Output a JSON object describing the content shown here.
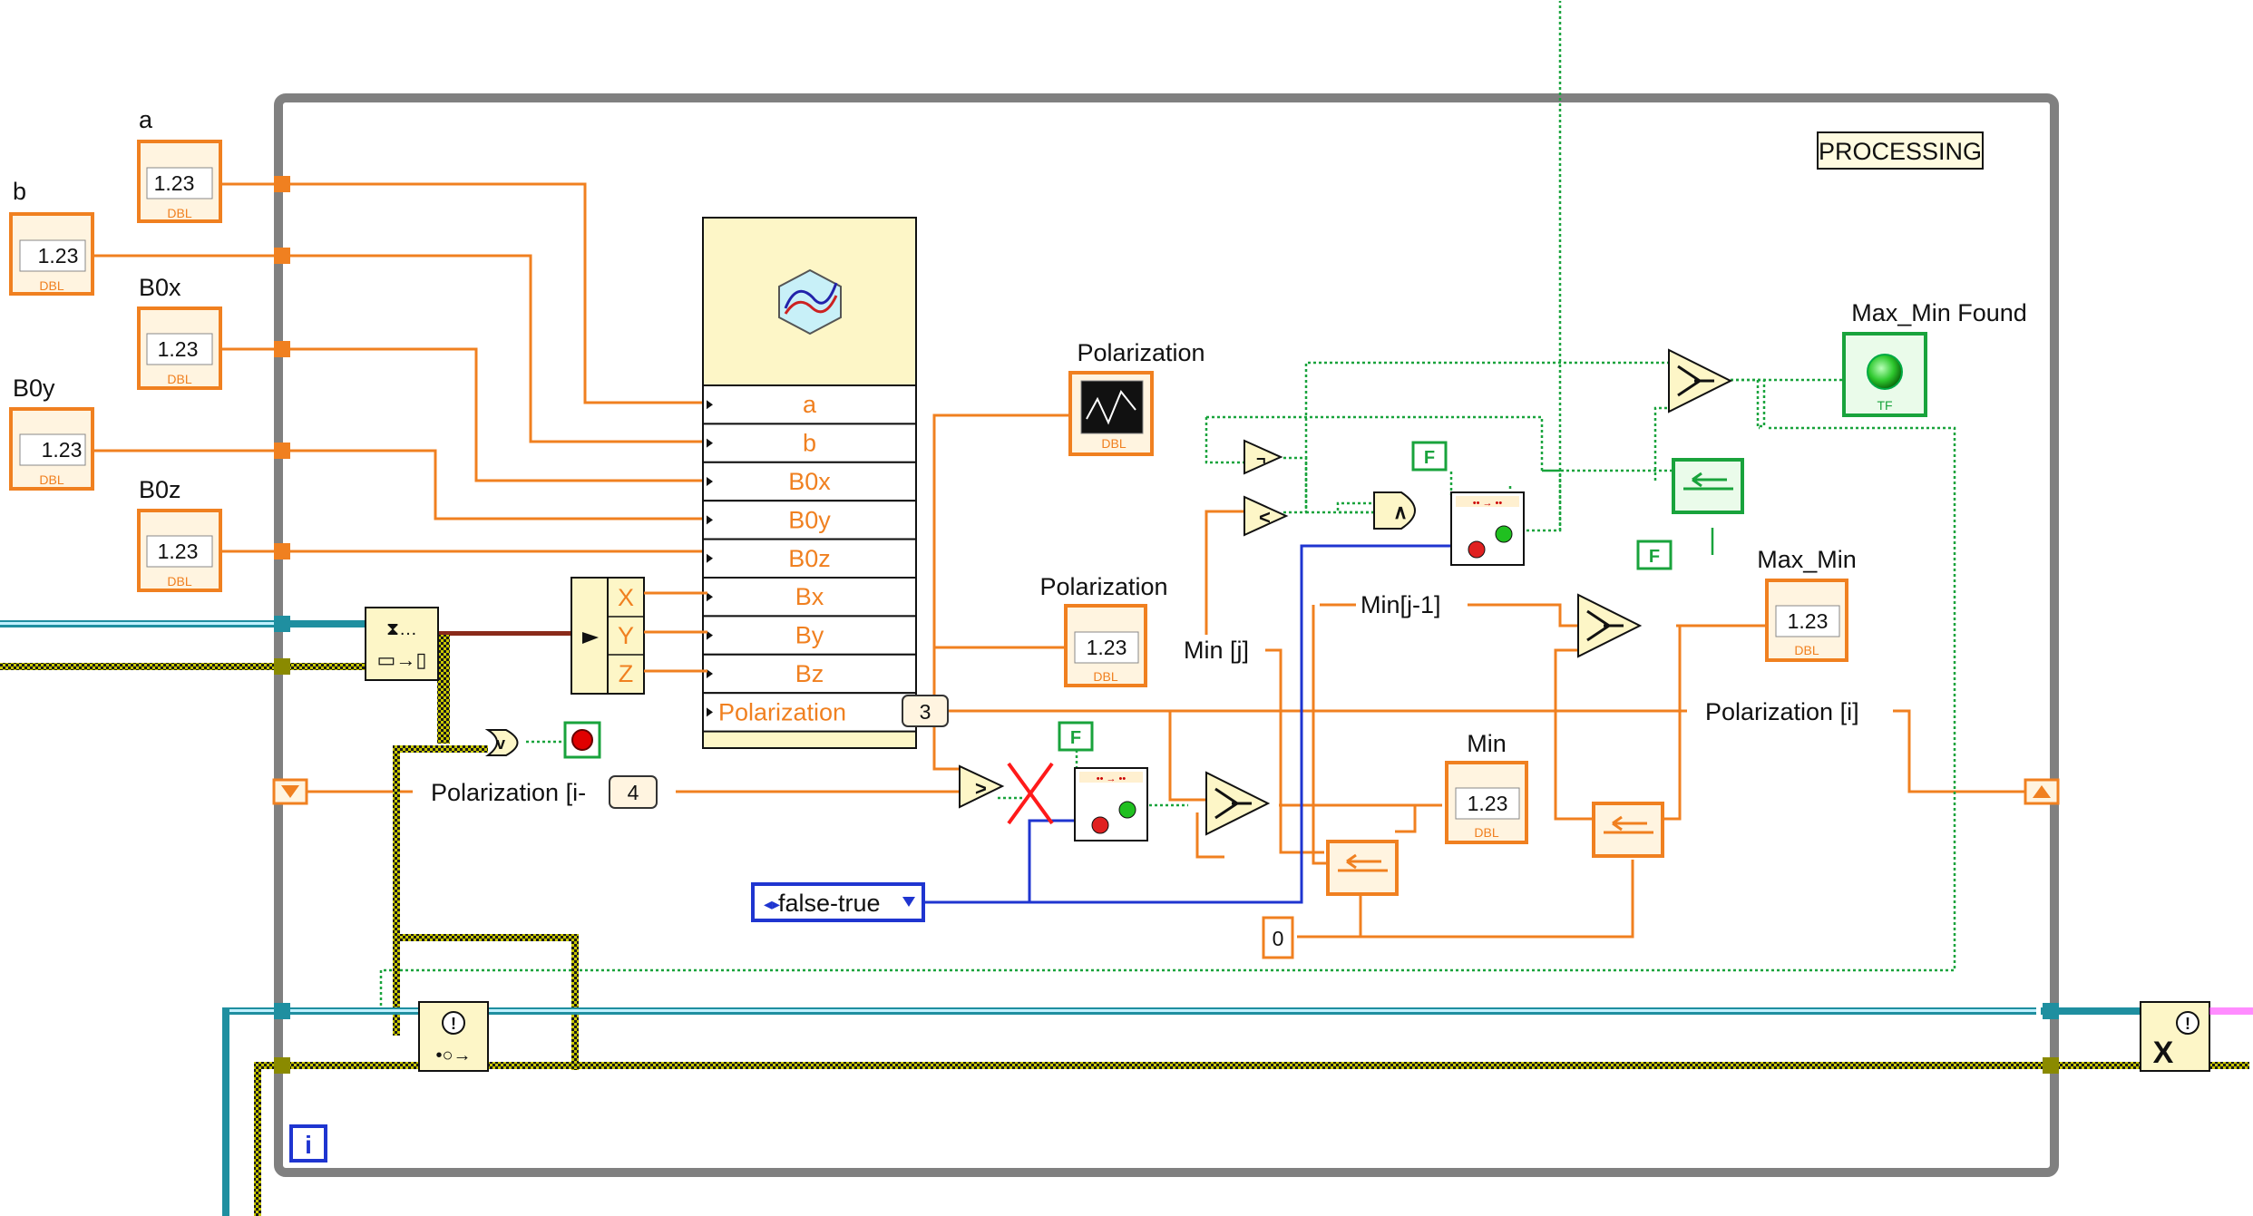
{
  "loop": {
    "state_label": "PROCESSING",
    "iteration_terminal": "i"
  },
  "controls": {
    "a": "a",
    "b": "b",
    "b0x": "B0x",
    "b0y": "B0y",
    "b0z": "B0z",
    "numeric_glyph": "1.23",
    "type_tag": "DBL"
  },
  "cluster": {
    "fields": [
      "a",
      "b",
      "B0x",
      "B0y",
      "B0z",
      "Bx",
      "By",
      "Bz",
      "Polarization"
    ],
    "polarization_index": "3"
  },
  "unbundle": {
    "fields": [
      "X",
      "Y",
      "Z"
    ]
  },
  "indicators": {
    "polarization_graph": "Polarization",
    "polarization_numeric": "Polarization",
    "min": "Min",
    "max_min": "Max_Min",
    "max_min_found": "Max_Min Found",
    "bool_tag": "TF"
  },
  "wire_labels": {
    "polarization_prev": "Polarization [i-",
    "polarization_prev_index": "4",
    "polarization_i": "Polarization [i]",
    "min_j": "Min [j]",
    "min_j_minus_1": "Min[j-1]"
  },
  "constants": {
    "false_const_1": "F",
    "false_const_2": "F",
    "false_const_3": "F",
    "zero": "0",
    "ring": "false-true"
  },
  "colors": {
    "dbl_wire": "#f08020",
    "bool_wire": "#19a33c",
    "ring_wire": "#1f35d0",
    "error_wire": "#8a8a00",
    "refnum_wire": "#1f8fa0",
    "loop_frame": "#7a7a7a",
    "primitive_fill": "#fdf6c7"
  }
}
